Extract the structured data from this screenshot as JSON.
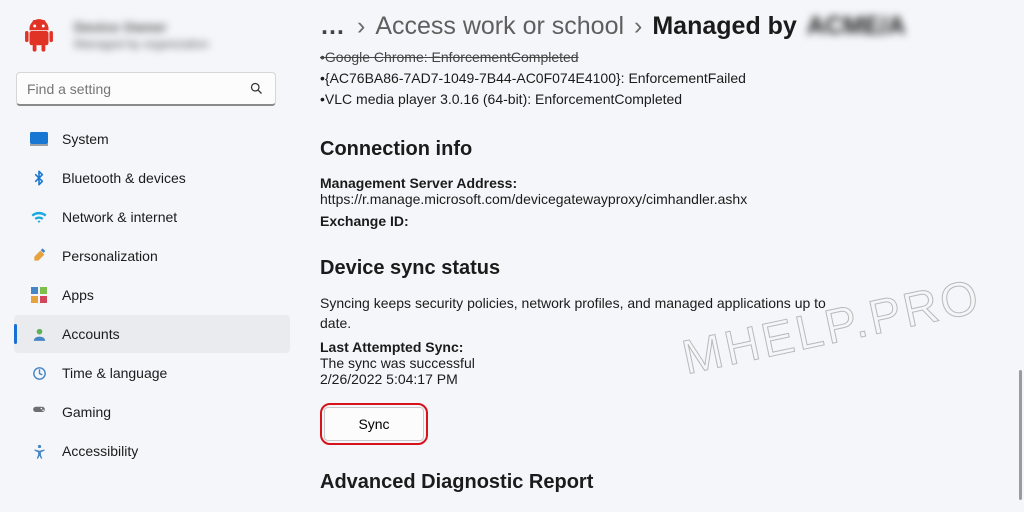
{
  "profile": {
    "name": "Device Owner",
    "sub": "Managed by organization"
  },
  "search": {
    "placeholder": "Find a setting"
  },
  "nav": {
    "system": "System",
    "bluetooth": "Bluetooth & devices",
    "network": "Network & internet",
    "personalization": "Personalization",
    "apps": "Apps",
    "accounts": "Accounts",
    "time": "Time & language",
    "gaming": "Gaming",
    "accessibility": "Accessibility"
  },
  "breadcrumb": {
    "more": "…",
    "parent": "Access work or school",
    "current_prefix": "Managed by",
    "current_blur": "ACME/A"
  },
  "policies": {
    "line0": "•Google Chrome: EnforcementCompleted",
    "line1": "•{AC76BA86-7AD7-1049-7B44-AC0F074E4100}: EnforcementFailed",
    "line2": "•VLC media player 3.0.16 (64-bit): EnforcementCompleted"
  },
  "conn": {
    "heading": "Connection info",
    "server_label": "Management Server Address:",
    "server_value": "https://r.manage.microsoft.com/devicegatewayproxy/cimhandler.ashx",
    "exchange_label": "Exchange ID:"
  },
  "sync": {
    "heading": "Device sync status",
    "desc": "Syncing keeps security policies, network profiles, and managed applications up to date.",
    "last_label": "Last Attempted Sync:",
    "last_result": "The sync was successful",
    "last_time": "2/26/2022 5:04:17 PM",
    "button": "Sync"
  },
  "adr": {
    "heading": "Advanced Diagnostic Report"
  },
  "watermark": "MHELP.PRO"
}
